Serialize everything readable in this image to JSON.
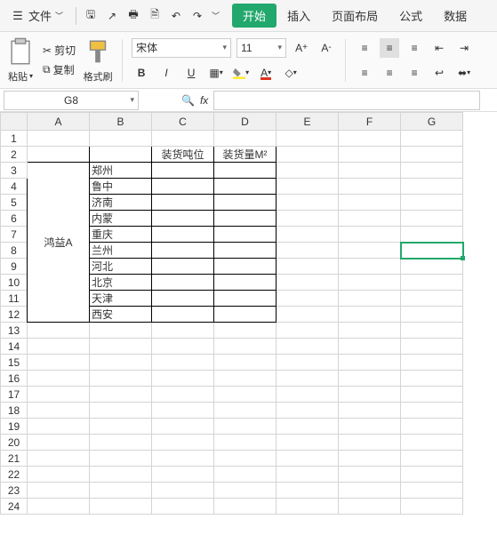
{
  "menubar": {
    "file": "文件",
    "tabs": [
      "开始",
      "插入",
      "页面布局",
      "公式",
      "数据"
    ],
    "active_tab": 0
  },
  "ribbon": {
    "paste": "粘贴",
    "cut": "剪切",
    "copy": "复制",
    "format_painter": "格式刷",
    "font_name": "宋体",
    "font_size": "11"
  },
  "namebox": "G8",
  "columns": [
    "A",
    "B",
    "C",
    "D",
    "E",
    "F",
    "G"
  ],
  "rows": 24,
  "chart_data": {
    "type": "table",
    "headers": {
      "C2": "装货吨位",
      "D2": "装货量M²"
    },
    "A3_12_merged": "鸿益A",
    "B_col": [
      "郑州",
      "鲁中",
      "济南",
      "内蒙",
      "重庆",
      "兰州",
      "河北",
      "北京",
      "天津",
      "西安"
    ]
  }
}
